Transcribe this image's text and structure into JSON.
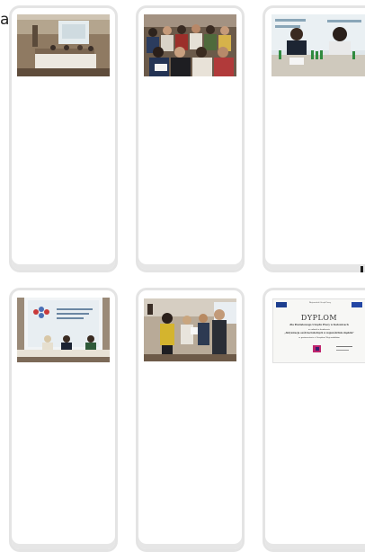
{
  "page": {
    "edge_text": "a"
  },
  "gallery": {
    "items": [
      {
        "id": "photo-1",
        "alt": "conference hall with presentation screen and panel table"
      },
      {
        "id": "photo-2",
        "alt": "audience seated in rows"
      },
      {
        "id": "photo-3",
        "alt": "two speakers at table in front of slide"
      },
      {
        "id": "photo-4",
        "alt": "panel of three speakers under projection screen"
      },
      {
        "id": "photo-5",
        "alt": "award handover between attendees"
      },
      {
        "id": "photo-6",
        "alt": "diploma certificate scan"
      }
    ]
  },
  "diploma": {
    "header": "Wojewódzki Urząd Pracy",
    "title": "DYPLOM",
    "recipient": "dla Powiatowego Urzędu Pracy w Katowicach",
    "line1": "za udział w konkursie",
    "line2": "„Aktywizacja osób bezrobotnych w województwie śląskim”",
    "line3": "w partnerstwie z Urzędem Wojewódzkim"
  }
}
